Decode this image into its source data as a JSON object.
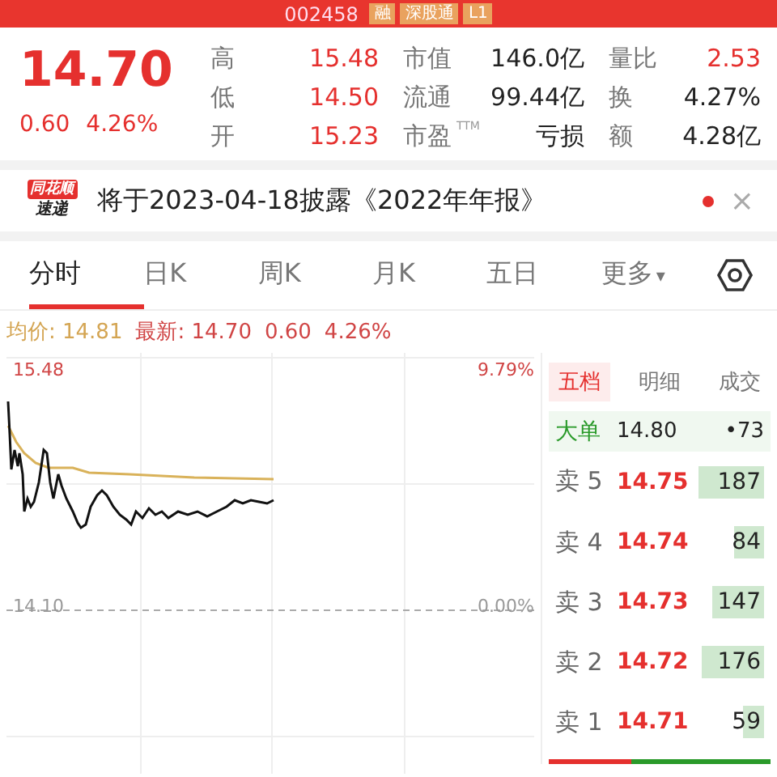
{
  "header": {
    "code": "002458",
    "badges": [
      "融",
      "深股通",
      "L1"
    ]
  },
  "quote": {
    "price": "14.70",
    "change": "0.60",
    "change_pct": "4.26%"
  },
  "stats": [
    [
      {
        "label": "高",
        "value": "15.48",
        "kind": "up"
      },
      {
        "label": "市值",
        "value": "146.0亿",
        "kind": "plain"
      },
      {
        "label": "量比",
        "value": "2.53",
        "kind": "up"
      }
    ],
    [
      {
        "label": "低",
        "value": "14.50",
        "kind": "up"
      },
      {
        "label": "流通",
        "value": "99.44亿",
        "kind": "plain"
      },
      {
        "label": "换",
        "value": "4.27%",
        "kind": "plain"
      }
    ],
    [
      {
        "label": "开",
        "value": "15.23",
        "kind": "up"
      },
      {
        "label": "市盈",
        "sup": "TTM",
        "value": "亏损",
        "kind": "plain"
      },
      {
        "label": "额",
        "value": "4.28亿",
        "kind": "plain"
      }
    ]
  ],
  "news": {
    "logo_top": "同花顺",
    "logo_bottom": "速递",
    "text": "将于2023-04-18披露《2022年年报》",
    "unread": true,
    "close": "×"
  },
  "tabs": [
    {
      "label": "分时",
      "selected": true
    },
    {
      "label": "日K",
      "selected": false
    },
    {
      "label": "周K",
      "selected": false
    },
    {
      "label": "月K",
      "selected": false
    },
    {
      "label": "五日",
      "selected": false
    },
    {
      "label": "更多",
      "selected": false,
      "caret": "▾"
    }
  ],
  "info": {
    "avg_label": "均价:",
    "avg": "14.81",
    "last_label": "最新:",
    "last": "14.70",
    "change": "0.60",
    "change_pct": "4.26%"
  },
  "chart": {
    "top_price": "15.48",
    "top_pct": "9.79%",
    "base_price": "14.10",
    "base_pct": "0.00%"
  },
  "book": {
    "tabs": [
      {
        "label": "五档",
        "selected": true
      },
      {
        "label": "明细",
        "selected": false
      },
      {
        "label": "成交",
        "selected": false
      }
    ],
    "big_order": {
      "label": "大单",
      "price": "14.80",
      "volume": "•73"
    },
    "rows": [
      {
        "label": "卖 5",
        "price": "14.75",
        "volume": "187"
      },
      {
        "label": "卖 4",
        "price": "14.74",
        "volume": "84"
      },
      {
        "label": "卖 3",
        "price": "14.73",
        "volume": "147"
      },
      {
        "label": "卖 2",
        "price": "14.72",
        "volume": "176"
      },
      {
        "label": "卖 1",
        "price": "14.71",
        "volume": "59"
      }
    ],
    "ratio": {
      "level": 0.37
    }
  }
}
